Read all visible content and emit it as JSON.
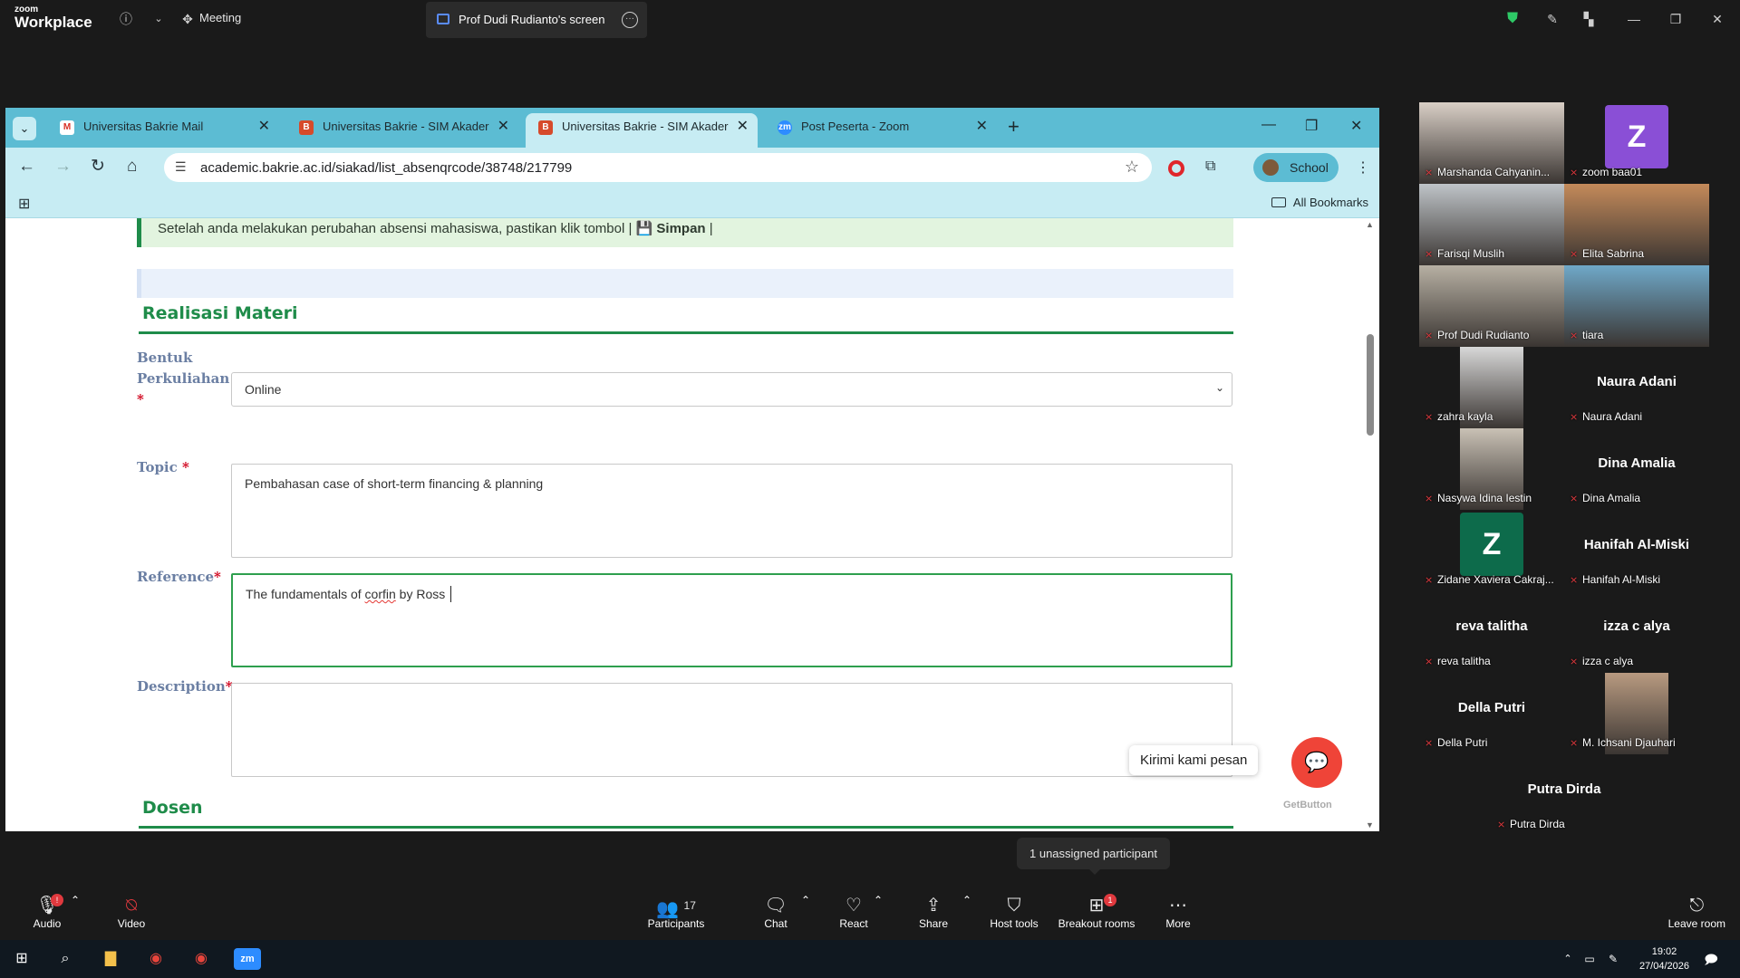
{
  "zoom": {
    "brand_small": "zoom",
    "brand_big": "Workplace",
    "meeting_label": "Meeting",
    "share_tab": "Prof Dudi Rudianto's screen"
  },
  "browser": {
    "tabs": [
      {
        "label": "Universitas Bakrie Mail",
        "icon": "gmail-icon"
      },
      {
        "label": "Universitas Bakrie - SIM Akader",
        "icon": "sim-icon"
      },
      {
        "label": "Universitas Bakrie - SIM Akader",
        "icon": "sim-icon"
      },
      {
        "label": "Post Peserta - Zoom",
        "icon": "zoom-icon"
      }
    ],
    "url": "academic.bakrie.ac.id/siakad/list_absenqrcode/38748/217799",
    "profile": "School",
    "all_bookmarks": "All Bookmarks"
  },
  "page": {
    "alert_text": "Setelah anda melakukan perubahan absensi mahasiswa, pastikan klik tombol | ",
    "alert_icon": "💾",
    "alert_bold": "Simpan",
    "alert_end": " |",
    "section_materi": "Realisasi Materi",
    "bentuk_label_1": "Bentuk",
    "bentuk_label_2": "Perkuliahan",
    "bentuk_value": "Online",
    "topic_label": "Topic",
    "topic_value": "Pembahasan case of short-term financing & planning",
    "reference_label": "Reference",
    "reference_pre": "The fundamentals of ",
    "reference_misspelled": "corfin",
    "reference_post": " by Ross",
    "description_label": "Description",
    "description_value": "",
    "section_dosen": "Dosen",
    "required_mark": "*",
    "chat_tooltip": "Kirimi kami pesan",
    "getbutton": "GetButton"
  },
  "participants": [
    {
      "name": "Marshanda Cahyanin...",
      "type": "video",
      "tone": "#d9cfc6"
    },
    {
      "name": "zoom baa01",
      "type": "avatar",
      "letter": "Z",
      "color": "#8a4fd6"
    },
    {
      "name": "Farisqi Muslih",
      "type": "video",
      "tone": "#bfc4c8"
    },
    {
      "name": "Elita Sabrina",
      "type": "video",
      "tone": "#c48a5a"
    },
    {
      "name": "Prof Dudi Rudianto",
      "type": "video",
      "tone": "#b7b0a3",
      "active": true
    },
    {
      "name": "tiara",
      "type": "video",
      "tone": "#6fa8c8"
    },
    {
      "name": "zahra kayla",
      "type": "video",
      "tone": "#d8d8d8"
    },
    {
      "name": "Naura Adani",
      "type": "name"
    },
    {
      "name": "Nasywa Idina Iestin",
      "type": "video",
      "tone": "#c9c1b5"
    },
    {
      "name": "Dina Amalia",
      "type": "name"
    },
    {
      "name": "Zidane Xaviera Cakraj...",
      "type": "avatar",
      "letter": "Z",
      "color": "#0d6b4b"
    },
    {
      "name": "Hanifah Al-Miski",
      "type": "name"
    },
    {
      "name": "reva talitha",
      "type": "name"
    },
    {
      "name": "izza c alya",
      "type": "name"
    },
    {
      "name": "Della Putri",
      "type": "name"
    },
    {
      "name": "M. Ichsani Djauhari",
      "type": "video",
      "tone": "#b89a80"
    },
    {
      "name": "Putra Dirda",
      "type": "name"
    }
  ],
  "toolbar": {
    "audio": "Audio",
    "video": "Video",
    "participants": "Participants",
    "participants_count": "17",
    "chat": "Chat",
    "react": "React",
    "share": "Share",
    "host_tools": "Host tools",
    "breakout": "Breakout rooms",
    "breakout_badge": "1",
    "more": "More",
    "leave": "Leave room",
    "unassigned": "1 unassigned participant"
  },
  "taskbar": {
    "time": "19:02",
    "date": "27/04/2026"
  }
}
